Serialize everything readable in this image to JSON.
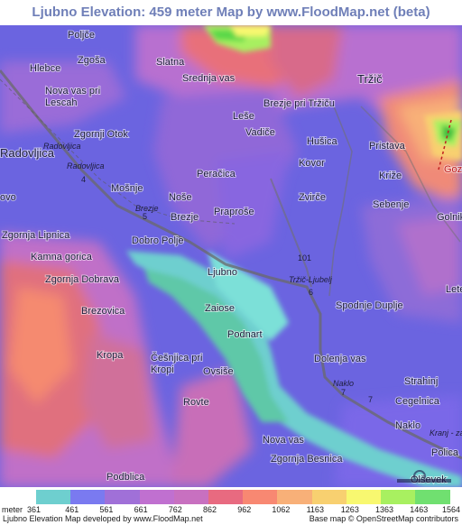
{
  "title": "Ljubno Elevation: 459 meter Map by www.FloodMap.net (beta)",
  "places": [
    {
      "id": "poljce",
      "name": "Poljče"
    },
    {
      "id": "zgosa",
      "name": "Zgoša"
    },
    {
      "id": "slatna",
      "name": "Slatna"
    },
    {
      "id": "hlebce",
      "name": "Hlebce"
    },
    {
      "id": "srednja-vas",
      "name": "Srednja vas"
    },
    {
      "id": "trzic",
      "name": "Tržič"
    },
    {
      "id": "nova-vas-pri-lescah",
      "name": "Nova vas pri\nLescah"
    },
    {
      "id": "brezje-pri-trzicu",
      "name": "Brezje pri Tržiču"
    },
    {
      "id": "lese",
      "name": "Leše"
    },
    {
      "id": "zgornji-otok",
      "name": "Zgornji Otok"
    },
    {
      "id": "vadice",
      "name": "Vadiče"
    },
    {
      "id": "husica",
      "name": "Hušica"
    },
    {
      "id": "pristava",
      "name": "Pristava"
    },
    {
      "id": "radovljica",
      "name": "Radovljica"
    },
    {
      "id": "kovor",
      "name": "Kovor"
    },
    {
      "id": "gozd",
      "name": "Gozd"
    },
    {
      "id": "perocica",
      "name": "Peračica"
    },
    {
      "id": "krize",
      "name": "Križe"
    },
    {
      "id": "mosnje",
      "name": "Mošnje"
    },
    {
      "id": "nose",
      "name": "Noše"
    },
    {
      "id": "ovo",
      "name": "ovo"
    },
    {
      "id": "zvirce",
      "name": "Zvirče"
    },
    {
      "id": "sebenje",
      "name": "Sebenje"
    },
    {
      "id": "praprose",
      "name": "Praproše"
    },
    {
      "id": "brezje",
      "name": "Brezje"
    },
    {
      "id": "golnik",
      "name": "Golnik"
    },
    {
      "id": "zgornja-lipnica",
      "name": "Zgornja Lipnica"
    },
    {
      "id": "dobro-polje",
      "name": "Dobro Polje"
    },
    {
      "id": "kamna-gorica",
      "name": "Kamna gorica"
    },
    {
      "id": "ljubno",
      "name": "Ljubno"
    },
    {
      "id": "zgornja-dobrava",
      "name": "Zgornja Dobrava"
    },
    {
      "id": "lete",
      "name": "Lete"
    },
    {
      "id": "brezovica",
      "name": "Brezovica"
    },
    {
      "id": "zaiose",
      "name": "Zaiose"
    },
    {
      "id": "spodnje-duplje",
      "name": "Spodnje Duplje"
    },
    {
      "id": "podnart",
      "name": "Podnart"
    },
    {
      "id": "kropa",
      "name": "Kropa"
    },
    {
      "id": "cesnjica-pri-kropi",
      "name": "Češnjica pri\nKropi"
    },
    {
      "id": "dolenja-vas",
      "name": "Dolenja vas"
    },
    {
      "id": "ovsise",
      "name": "Ovsiše"
    },
    {
      "id": "strahinj",
      "name": "Strahinj"
    },
    {
      "id": "cegelnica",
      "name": "Cegelnica"
    },
    {
      "id": "rovte",
      "name": "Rovte"
    },
    {
      "id": "naklo",
      "name": "Naklo"
    },
    {
      "id": "nova-vas",
      "name": "Nova vas"
    },
    {
      "id": "polica",
      "name": "Polica"
    },
    {
      "id": "zgornja-besnica",
      "name": "Zgornja Besnica"
    },
    {
      "id": "podblica",
      "name": "Podblica"
    },
    {
      "id": "olsevek",
      "name": "Olševek"
    }
  ],
  "road_labels": [
    {
      "id": "radovljica-road-1",
      "text": "Radovljica"
    },
    {
      "id": "radovljica-road-2",
      "text": "Radovljica"
    },
    {
      "id": "brezje-road",
      "text": "Brezje"
    },
    {
      "id": "trzic-ljubelj-road",
      "text": "Tržič-Ljubelj"
    },
    {
      "id": "naklo-road",
      "text": "Naklo"
    },
    {
      "id": "kranj-road",
      "text": "Kranj - za"
    }
  ],
  "road_numbers": [
    {
      "id": "r4",
      "text": "4"
    },
    {
      "id": "r5",
      "text": "5"
    },
    {
      "id": "r101",
      "text": "101"
    },
    {
      "id": "r6",
      "text": "6"
    },
    {
      "id": "r7a",
      "text": "7"
    },
    {
      "id": "r7b",
      "text": "7"
    }
  ],
  "legend": {
    "unit_label": "meter",
    "ticks": [
      "361",
      "461",
      "561",
      "661",
      "762",
      "862",
      "962",
      "1062",
      "1163",
      "1263",
      "1363",
      "1463",
      "1564"
    ],
    "colors": [
      "#6ecfcf",
      "#7a7af0",
      "#a070d8",
      "#c070d0",
      "#c870c0",
      "#e86a80",
      "#f88872",
      "#f8b078",
      "#f8d070",
      "#f8f870",
      "#a8f060",
      "#70e070"
    ]
  },
  "footer": {
    "left": "Ljubno Elevation Map developed by www.FloodMap.net",
    "right": "Base map © OpenStreetMap contributors"
  }
}
